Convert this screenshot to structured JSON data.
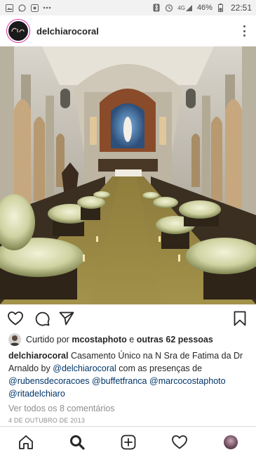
{
  "status_bar": {
    "time": "22:51",
    "battery": "46%",
    "network": "4G"
  },
  "post": {
    "username": "delchiarocoral",
    "avatar_logo_text": "Cia",
    "likes": {
      "prefix": "Curtido por",
      "first_user": "mcostaphoto",
      "connector": "e",
      "others": "outras 62 pessoas"
    },
    "caption": {
      "user": "delchiarocoral",
      "text1": "Casamento Único na N Sra de Fatima da Dr Arnaldo by",
      "mention1": "@delchiarocoral",
      "text2": "com as presenças de",
      "mention2": "@rubensdecoracoes",
      "mention3": "@buffetfranca",
      "mention4": "@marcocostaphoto",
      "mention5": "@ritadelchiaro"
    },
    "comments_link": "Ver todos os 8 comentários",
    "date": "4 DE OUTUBRO DE 2013"
  },
  "icons": {
    "status_left": [
      "photo-notification-icon",
      "whatsapp-icon",
      "gallery-icon",
      "overflow-dots-icon"
    ],
    "status_right": [
      "bluetooth-icon",
      "alarm-icon",
      "network-icon",
      "battery-icon"
    ],
    "actions": [
      "heart-icon",
      "comment-icon",
      "share-icon",
      "bookmark-icon"
    ],
    "nav": [
      "home-icon",
      "search-icon",
      "new-post-icon",
      "activity-icon",
      "profile-icon"
    ]
  },
  "colors": {
    "mention": "#003569",
    "text": "#262626",
    "muted": "#8e8e8e",
    "story_ring": "#d6249f"
  }
}
